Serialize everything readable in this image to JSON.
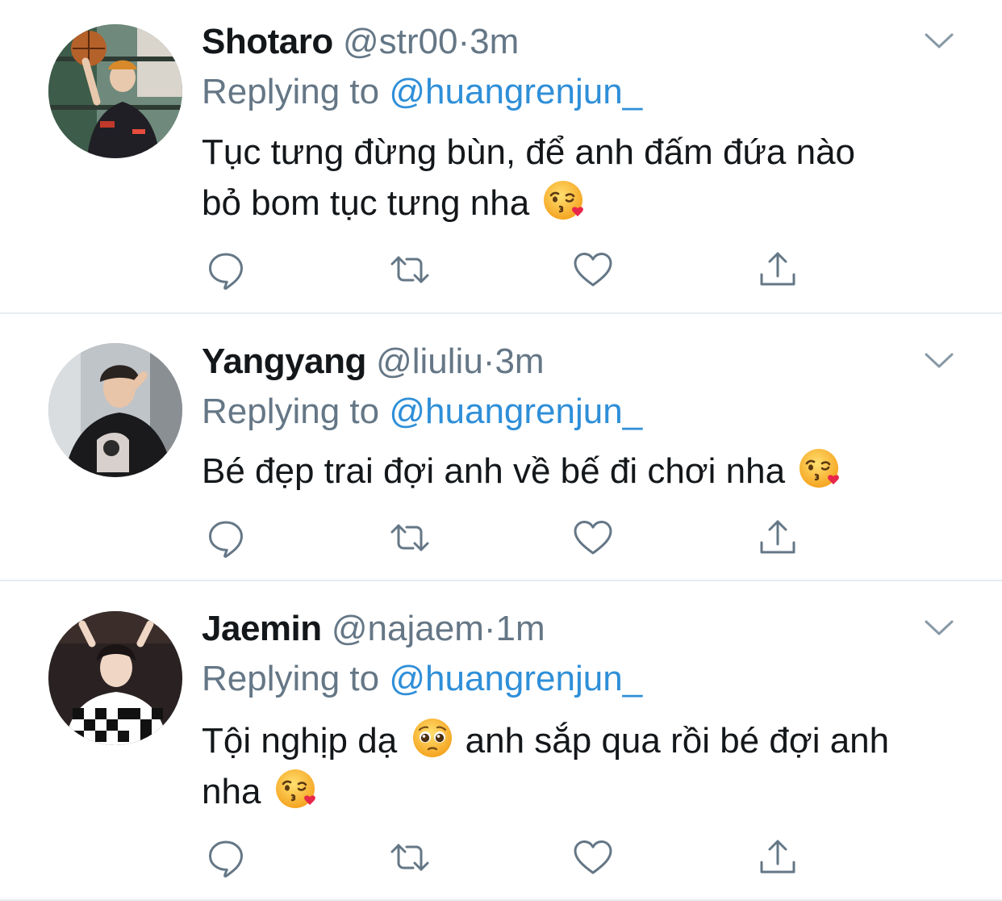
{
  "tweets": [
    {
      "name": "Shotaro",
      "handle": "@str00",
      "dot": "·",
      "time": "3m",
      "replying_label": "Replying to",
      "replying_to": "@huangrenjun_",
      "text_lines": [
        "Tục tưng đừng bùn, để anh đấm đứa nào",
        "bỏ bom tục tưng nha"
      ],
      "emoji": "kissing-heart-emoji"
    },
    {
      "name": "Yangyang",
      "handle": "@liuliu",
      "dot": "·",
      "time": "3m",
      "replying_label": "Replying to",
      "replying_to": "@huangrenjun_",
      "text_lines": [
        "Bé đẹp trai đợi anh về bế đi chơi nha"
      ],
      "emoji": "kissing-heart-emoji"
    },
    {
      "name": "Jaemin",
      "handle": "@najaem",
      "dot": "·",
      "time": "1m",
      "replying_label": "Replying to",
      "replying_to": "@huangrenjun_",
      "text_lines": [
        "Tội nghịp dạ",
        "anh sắp qua rồi bé đợi anh",
        "nha"
      ],
      "emoji": "kissing-heart-emoji",
      "inline_emoji": "pleading-face-emoji"
    }
  ],
  "colors": {
    "text": "#14171a",
    "secondary": "#657786",
    "link": "#2f8fd8",
    "separator": "#e6ecf0",
    "icon": "#657786"
  },
  "icons": [
    "reply-icon",
    "retweet-icon",
    "like-icon",
    "share-icon",
    "chevron-down-icon"
  ]
}
